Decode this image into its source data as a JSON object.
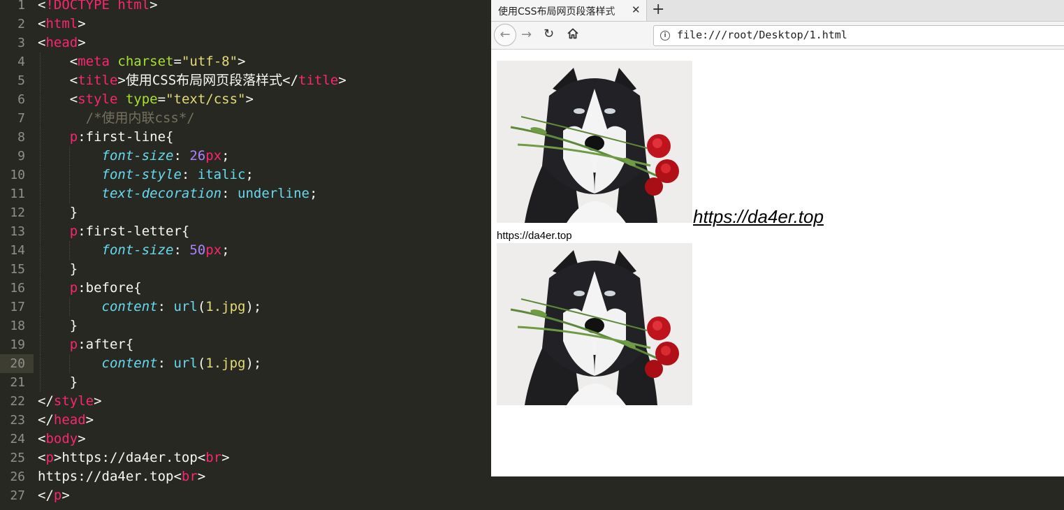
{
  "editor": {
    "active_line": 20,
    "lines": [
      {
        "n": "1",
        "tokens": [
          [
            "pun",
            "<"
          ],
          [
            "tag",
            "!DOCTYPE html"
          ],
          [
            "pun",
            ">"
          ]
        ]
      },
      {
        "n": "2",
        "tokens": [
          [
            "pun",
            "<"
          ],
          [
            "tag",
            "html"
          ],
          [
            "pun",
            ">"
          ]
        ]
      },
      {
        "n": "3",
        "tokens": [
          [
            "pun",
            "<"
          ],
          [
            "tag",
            "head"
          ],
          [
            "pun",
            ">"
          ]
        ]
      },
      {
        "n": "4",
        "tokens": [
          [
            "pun",
            "    <"
          ],
          [
            "tag",
            "meta"
          ],
          [
            "pun",
            " "
          ],
          [
            "attr",
            "charset"
          ],
          [
            "pun",
            "="
          ],
          [
            "str",
            "\"utf-8\""
          ],
          [
            "pun",
            ">"
          ]
        ]
      },
      {
        "n": "5",
        "tokens": [
          [
            "pun",
            "    <"
          ],
          [
            "tag",
            "title"
          ],
          [
            "pun",
            ">使用CSS布局网页段落样式</"
          ],
          [
            "tag",
            "title"
          ],
          [
            "pun",
            ">"
          ]
        ]
      },
      {
        "n": "6",
        "tokens": [
          [
            "pun",
            "    <"
          ],
          [
            "tag",
            "style"
          ],
          [
            "pun",
            " "
          ],
          [
            "attr",
            "type"
          ],
          [
            "pun",
            "="
          ],
          [
            "str",
            "\"text/css\""
          ],
          [
            "pun",
            ">"
          ]
        ]
      },
      {
        "n": "7",
        "tokens": [
          [
            "com",
            "      /*使用内联css*/"
          ]
        ]
      },
      {
        "n": "8",
        "tokens": [
          [
            "pun",
            "    "
          ],
          [
            "tag",
            "p"
          ],
          [
            "pun",
            ":first-line{"
          ]
        ]
      },
      {
        "n": "9",
        "tokens": [
          [
            "pun",
            "        "
          ],
          [
            "prop",
            "font-size"
          ],
          [
            "pun",
            ": "
          ],
          [
            "num",
            "26"
          ],
          [
            "unit",
            "px"
          ],
          [
            "pun",
            ";"
          ]
        ]
      },
      {
        "n": "10",
        "tokens": [
          [
            "pun",
            "        "
          ],
          [
            "prop",
            "font-style"
          ],
          [
            "pun",
            ": "
          ],
          [
            "val",
            "italic"
          ],
          [
            "pun",
            ";"
          ]
        ]
      },
      {
        "n": "11",
        "tokens": [
          [
            "pun",
            "        "
          ],
          [
            "prop",
            "text-decoration"
          ],
          [
            "pun",
            ": "
          ],
          [
            "val",
            "underline"
          ],
          [
            "pun",
            ";"
          ]
        ]
      },
      {
        "n": "12",
        "tokens": [
          [
            "pun",
            "    }"
          ]
        ]
      },
      {
        "n": "13",
        "tokens": [
          [
            "pun",
            "    "
          ],
          [
            "tag",
            "p"
          ],
          [
            "pun",
            ":first-letter{"
          ]
        ]
      },
      {
        "n": "14",
        "tokens": [
          [
            "pun",
            "        "
          ],
          [
            "prop",
            "font-size"
          ],
          [
            "pun",
            ": "
          ],
          [
            "num",
            "50"
          ],
          [
            "unit",
            "px"
          ],
          [
            "pun",
            ";"
          ]
        ]
      },
      {
        "n": "15",
        "tokens": [
          [
            "pun",
            "    }"
          ]
        ]
      },
      {
        "n": "16",
        "tokens": [
          [
            "pun",
            "    "
          ],
          [
            "tag",
            "p"
          ],
          [
            "pun",
            ":before{"
          ]
        ]
      },
      {
        "n": "17",
        "tokens": [
          [
            "pun",
            "        "
          ],
          [
            "prop",
            "content"
          ],
          [
            "pun",
            ": "
          ],
          [
            "val",
            "url"
          ],
          [
            "pun",
            "("
          ],
          [
            "str",
            "1.jpg"
          ],
          [
            "pun",
            ");"
          ]
        ]
      },
      {
        "n": "18",
        "tokens": [
          [
            "pun",
            "    }"
          ]
        ]
      },
      {
        "n": "19",
        "tokens": [
          [
            "pun",
            "    "
          ],
          [
            "tag",
            "p"
          ],
          [
            "pun",
            ":after{"
          ]
        ]
      },
      {
        "n": "20",
        "tokens": [
          [
            "pun",
            "        "
          ],
          [
            "prop",
            "content"
          ],
          [
            "pun",
            ": "
          ],
          [
            "val",
            "url"
          ],
          [
            "pun",
            "("
          ],
          [
            "str",
            "1.jpg"
          ],
          [
            "pun",
            ");"
          ]
        ]
      },
      {
        "n": "21",
        "tokens": [
          [
            "pun",
            "    }"
          ]
        ]
      },
      {
        "n": "22",
        "tokens": [
          [
            "pun",
            "</"
          ],
          [
            "tag",
            "style"
          ],
          [
            "pun",
            ">"
          ]
        ]
      },
      {
        "n": "23",
        "tokens": [
          [
            "pun",
            "</"
          ],
          [
            "tag",
            "head"
          ],
          [
            "pun",
            ">"
          ]
        ]
      },
      {
        "n": "24",
        "tokens": [
          [
            "pun",
            "<"
          ],
          [
            "tag",
            "body"
          ],
          [
            "pun",
            ">"
          ]
        ]
      },
      {
        "n": "25",
        "tokens": [
          [
            "pun",
            "<"
          ],
          [
            "tag",
            "p"
          ],
          [
            "pun",
            ">https://da4er.top<"
          ],
          [
            "tag",
            "br"
          ],
          [
            "pun",
            ">"
          ]
        ]
      },
      {
        "n": "26",
        "tokens": [
          [
            "pun",
            "https://da4er.top<"
          ],
          [
            "tag",
            "br"
          ],
          [
            "pun",
            ">"
          ]
        ]
      },
      {
        "n": "27",
        "tokens": [
          [
            "pun",
            "</"
          ],
          [
            "tag",
            "p"
          ],
          [
            "pun",
            ">"
          ]
        ]
      }
    ]
  },
  "browser": {
    "tab_title": "使用CSS布局网页段落样式",
    "tab_close": "✕",
    "new_tab": "+",
    "back_icon": "←",
    "forward_icon": "→",
    "reload_icon": "↻",
    "info_icon": "i",
    "url": "file:///root/Desktop/1.html",
    "page": {
      "line1": "https://da4er.top",
      "line2": "https://da4er.top"
    }
  },
  "colors": {
    "editor_bg": "#272822",
    "tag": "#f92672",
    "attr": "#a6e22e",
    "string": "#e6db74",
    "comment": "#75715e",
    "property": "#66d9ef",
    "number": "#ae81ff"
  }
}
